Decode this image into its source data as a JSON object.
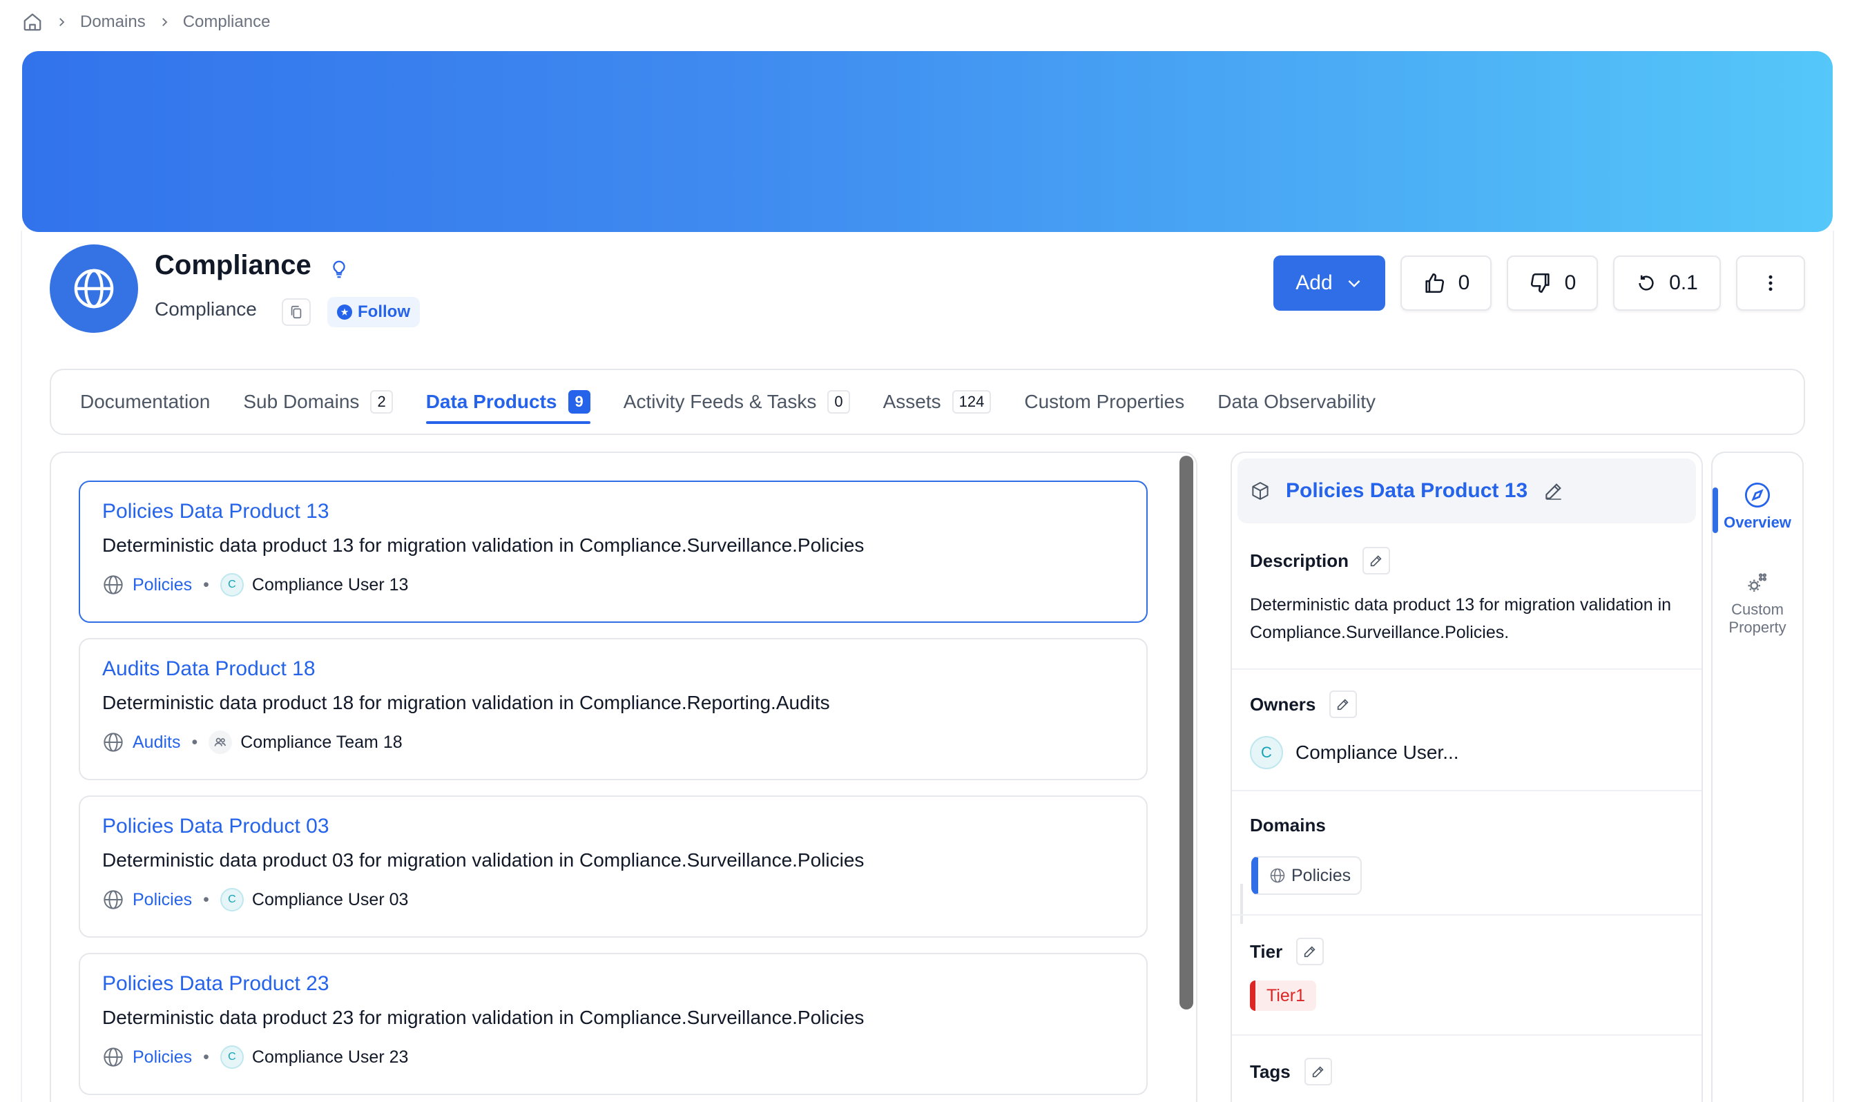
{
  "breadcrumb": {
    "items": [
      "Domains",
      "Compliance"
    ]
  },
  "header": {
    "title": "Compliance",
    "subtitle": "Compliance",
    "follow_label": "Follow",
    "add_label": "Add",
    "likes": "0",
    "dislikes": "0",
    "version": "0.1"
  },
  "tabs": [
    {
      "label": "Documentation"
    },
    {
      "label": "Sub Domains",
      "count": "2"
    },
    {
      "label": "Data Products",
      "count": "9",
      "active": true
    },
    {
      "label": "Activity Feeds & Tasks",
      "count": "0"
    },
    {
      "label": "Assets",
      "count": "124"
    },
    {
      "label": "Custom Properties"
    },
    {
      "label": "Data Observability"
    }
  ],
  "products": [
    {
      "title": "Policies Data Product 13",
      "description": "Deterministic data product 13 for migration validation in Compliance.Surveillance.Policies",
      "domain": "Policies",
      "owner": "Compliance User 13",
      "owner_initial": "C",
      "owner_type": "user"
    },
    {
      "title": "Audits Data Product 18",
      "description": "Deterministic data product 18 for migration validation in Compliance.Reporting.Audits",
      "domain": "Audits",
      "owner": "Compliance Team 18",
      "owner_initial": "",
      "owner_type": "team"
    },
    {
      "title": "Policies Data Product 03",
      "description": "Deterministic data product 03 for migration validation in Compliance.Surveillance.Policies",
      "domain": "Policies",
      "owner": "Compliance User 03",
      "owner_initial": "C",
      "owner_type": "user"
    },
    {
      "title": "Policies Data Product 23",
      "description": "Deterministic data product 23 for migration validation in Compliance.Surveillance.Policies",
      "domain": "Policies",
      "owner": "Compliance User 23",
      "owner_initial": "C",
      "owner_type": "user"
    }
  ],
  "detail": {
    "title": "Policies Data Product 13",
    "description_label": "Description",
    "description": "Deterministic data product 13 for migration validation in Compliance.Surveillance.Policies.",
    "owners_label": "Owners",
    "owner_initial": "C",
    "owner_name": "Compliance User...",
    "domains_label": "Domains",
    "domain": "Policies",
    "tier_label": "Tier",
    "tier": "Tier1",
    "tags_label": "Tags"
  },
  "rail": {
    "overview": "Overview",
    "custom_property": "Custom Property"
  },
  "colors": {
    "primary": "#2f6ee6",
    "link": "#2563eb",
    "tier": "#dc2626",
    "banner_start": "#3273ec",
    "banner_end": "#55c7f9"
  }
}
